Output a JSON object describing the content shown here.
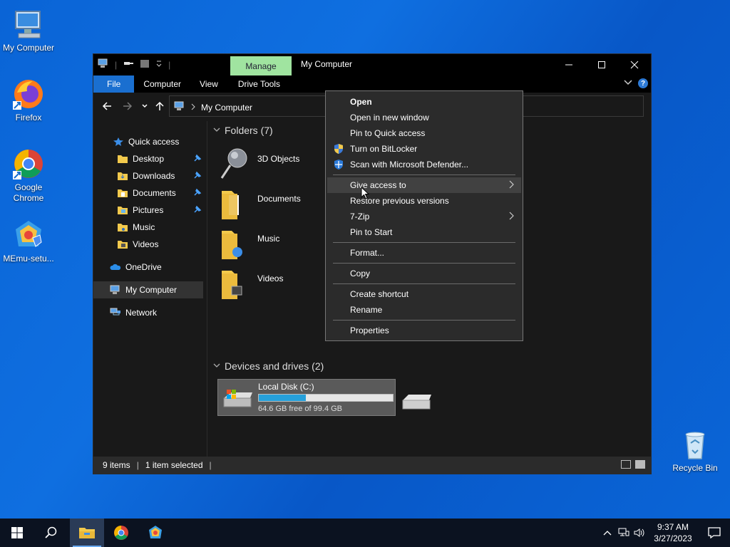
{
  "desktop": {
    "icons": [
      {
        "label": "My Computer"
      },
      {
        "label": "Firefox"
      },
      {
        "label": "Google Chrome"
      },
      {
        "label": "MEmu-setu..."
      },
      {
        "label": "Recycle Bin"
      }
    ]
  },
  "window": {
    "manage_tab": "Manage",
    "title": "My Computer",
    "ribbon_tabs": [
      "File",
      "Computer",
      "View",
      "Drive Tools"
    ],
    "address": "My Computer",
    "help": "?"
  },
  "nav_pane": {
    "items": [
      {
        "label": "Quick access"
      },
      {
        "label": "Desktop"
      },
      {
        "label": "Downloads"
      },
      {
        "label": "Documents"
      },
      {
        "label": "Pictures"
      },
      {
        "label": "Music"
      },
      {
        "label": "Videos"
      },
      {
        "label": "OneDrive"
      },
      {
        "label": "My Computer"
      },
      {
        "label": "Network"
      }
    ]
  },
  "content": {
    "folders_header": "Folders (7)",
    "folders": [
      "3D Objects",
      "Documents",
      "Music",
      "Videos"
    ],
    "devices_header": "Devices and drives (2)",
    "drive": {
      "name": "Local Disk (C:)",
      "free_text": "64.6 GB free of 99.4 GB",
      "used_fraction": 0.35
    }
  },
  "status": {
    "items": "9 items",
    "selected": "1 item selected"
  },
  "context_menu": {
    "items": [
      "Open",
      "Open in new window",
      "Pin to Quick access",
      "Turn on BitLocker",
      "Scan with Microsoft Defender...",
      "Give access to",
      "Restore previous versions",
      "7-Zip",
      "Pin to Start",
      "Format...",
      "Copy",
      "Create shortcut",
      "Rename",
      "Properties"
    ]
  },
  "taskbar": {
    "time": "9:37 AM",
    "date": "3/27/2023"
  },
  "colors": {
    "accent": "#1a6fd0",
    "manage_tab": "#a0e4a0",
    "drive_fill": "#26a0da"
  }
}
